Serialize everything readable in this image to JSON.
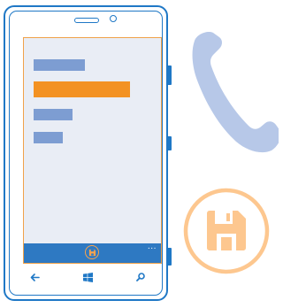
{
  "colors": {
    "phone_outline": "#1f78c6",
    "screen_background": "#e9edf5",
    "screen_border": "#f0a24a",
    "list_item": "#7d9dd2",
    "list_item_selected": "#f39223",
    "app_bar": "#2e79c2",
    "save_accent": "#f7a34e",
    "phone_illustration": "#b7c8e8",
    "save_illustration": "#fdc78f"
  },
  "screen": {
    "list_items": [
      {
        "state": "normal"
      },
      {
        "state": "selected"
      },
      {
        "state": "normal"
      },
      {
        "state": "normal"
      }
    ],
    "app_bar": {
      "primary_icon": "save-icon",
      "more_label": "..."
    }
  },
  "hardware_keys": {
    "back": "back-arrow-icon",
    "start": "windows-logo-icon",
    "search": "search-icon"
  },
  "illustrations": {
    "call": "phone-handset-icon",
    "save": "save-floppy-icon"
  }
}
